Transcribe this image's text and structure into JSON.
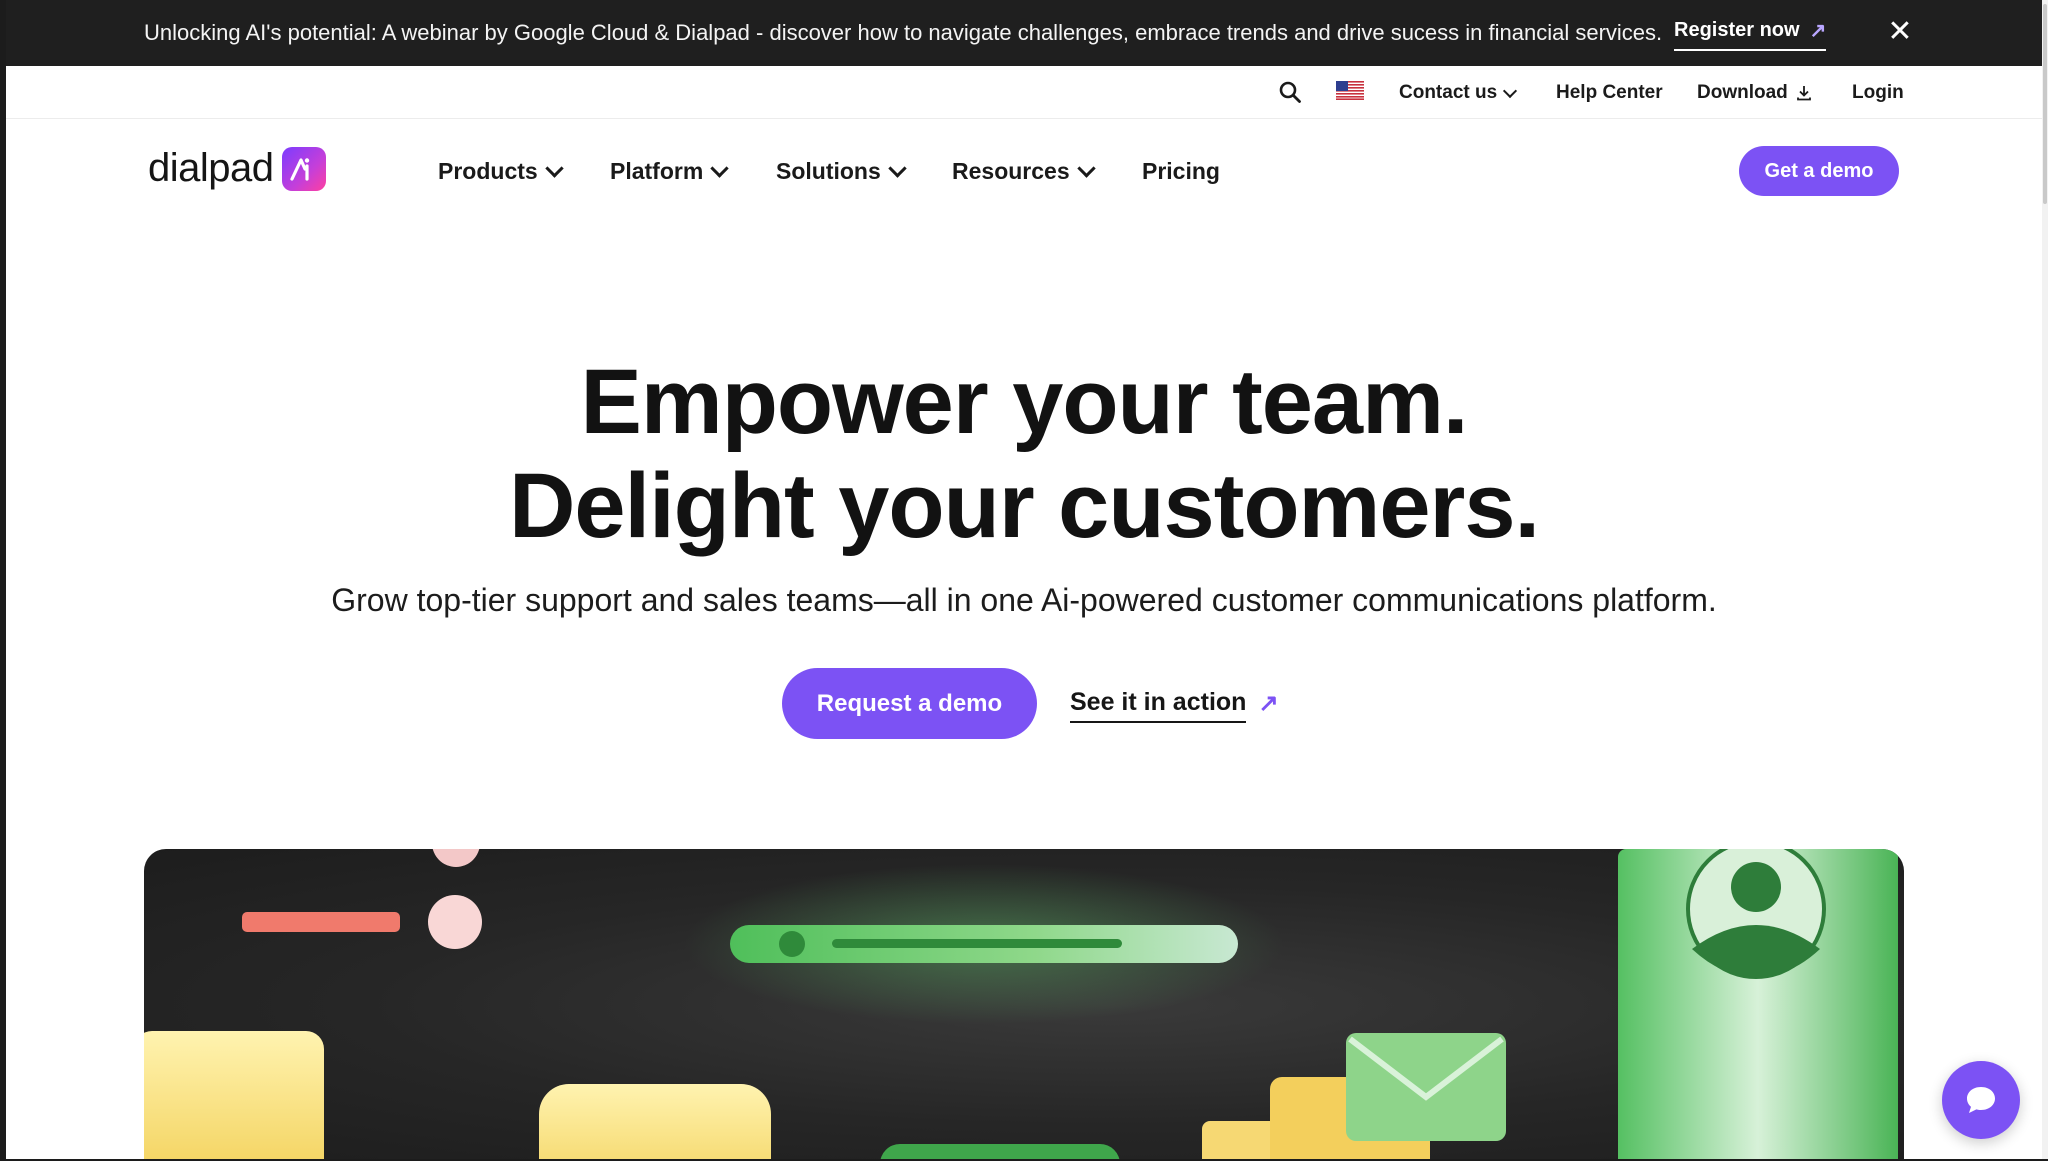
{
  "announcement": {
    "text": "Unlocking AI's potential: A webinar by Google Cloud & Dialpad - discover how to navigate challenges, embrace trends and drive sucess in financial services.",
    "cta_label": "Register now",
    "cta_icon": "arrow-up-right-icon",
    "close_icon": "close-icon"
  },
  "utility_nav": {
    "search_icon": "search-icon",
    "flag_icon": "us-flag-icon",
    "contact_label": "Contact us",
    "help_label": "Help Center",
    "download_label": "Download",
    "login_label": "Login"
  },
  "main_nav": {
    "logo_text": "dialpad",
    "items": [
      {
        "label": "Products"
      },
      {
        "label": "Platform"
      },
      {
        "label": "Solutions"
      },
      {
        "label": "Resources"
      },
      {
        "label": "Pricing"
      }
    ],
    "demo_label": "Get a demo"
  },
  "hero": {
    "title_line1": "Empower your team.",
    "title_line2": "Delight your customers.",
    "subtitle": "Grow top-tier support and sales teams—all in one Ai-powered customer communications platform.",
    "primary_cta": "Request a demo",
    "secondary_cta": "See it in action"
  },
  "colors": {
    "accent": "#7c52f4",
    "announcement_bg": "#1f1f1f",
    "showcase_bg": "#262626"
  }
}
